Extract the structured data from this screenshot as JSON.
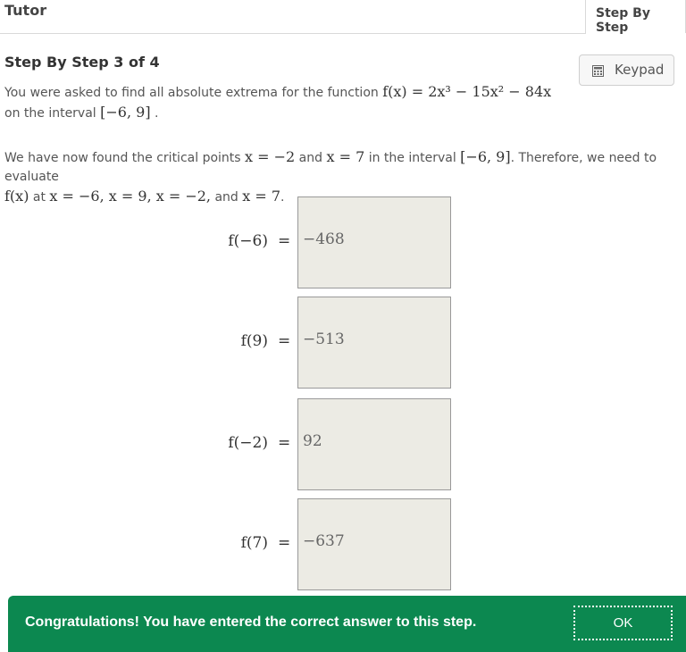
{
  "header": {
    "title": "Tutor",
    "tab_label": "Step By Step"
  },
  "step": {
    "title": "Step By Step 3 of 4"
  },
  "keypad": {
    "label": "Keypad",
    "icon": "calculator-icon"
  },
  "intro": {
    "t1": "You were asked to find all absolute extrema for the function",
    "func": "f(x) = 2x³ − 15x² − 84x",
    "t2": "on the interval",
    "interval": "[−6, 9]",
    "t3": "."
  },
  "critical": {
    "t1": "We have now found the critical points",
    "cp1": "x = −2",
    "t2": "and",
    "cp2": "x = 7",
    "t3": "in the interval",
    "interval": "[−6, 9]",
    "t4": ". Therefore, we need to evaluate",
    "fx": "f(x)",
    "t5": "at",
    "points": "x = −6, x = 9, x = −2,",
    "t6": "and",
    "last": "x = 7",
    "t7": "."
  },
  "equations": [
    {
      "label": "f(−6)",
      "equals": "=",
      "value": "−468"
    },
    {
      "label": "f(9)",
      "equals": "=",
      "value": "−513"
    },
    {
      "label": "f(−2)",
      "equals": "=",
      "value": "92"
    },
    {
      "label": "f(7)",
      "equals": "=",
      "value": "−637"
    }
  ],
  "feedback": {
    "message": "Congratulations! You have entered the correct answer to this step.",
    "ok_label": "OK"
  },
  "colors": {
    "success_green": "#0c8850",
    "answer_box_bg": "#ecebe4"
  }
}
